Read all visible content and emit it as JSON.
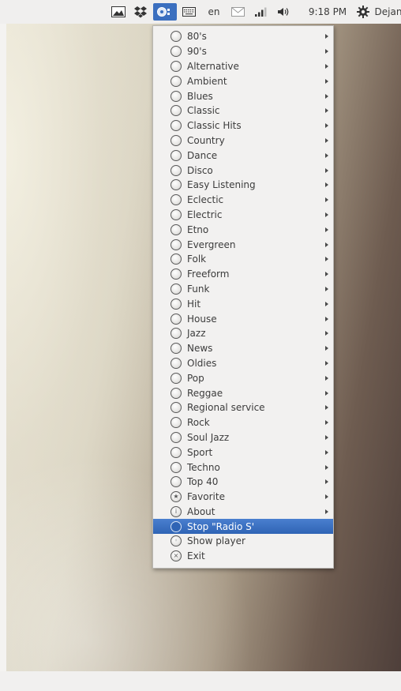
{
  "panel": {
    "language": "en",
    "clock": "9:18 PM",
    "user": "Dejan",
    "indicators": [
      {
        "name": "screenshot-icon"
      },
      {
        "name": "dropbox-icon"
      },
      {
        "name": "radio-tray-icon"
      },
      {
        "name": "keyboard-icon"
      },
      {
        "name": "mail-icon"
      },
      {
        "name": "network-signal-icon"
      },
      {
        "name": "volume-icon"
      },
      {
        "name": "gear-icon"
      }
    ]
  },
  "menu": {
    "items": [
      {
        "label": "80's",
        "submenu": true
      },
      {
        "label": "90's",
        "submenu": true
      },
      {
        "label": "Alternative",
        "submenu": true
      },
      {
        "label": "Ambient",
        "submenu": true
      },
      {
        "label": "Blues",
        "submenu": true
      },
      {
        "label": "Classic",
        "submenu": true
      },
      {
        "label": "Classic Hits",
        "submenu": true
      },
      {
        "label": "Country",
        "submenu": true
      },
      {
        "label": "Dance",
        "submenu": true
      },
      {
        "label": "Disco",
        "submenu": true
      },
      {
        "label": "Easy Listening",
        "submenu": true
      },
      {
        "label": "Eclectic",
        "submenu": true
      },
      {
        "label": "Electric",
        "submenu": true
      },
      {
        "label": "Etno",
        "submenu": true
      },
      {
        "label": "Evergreen",
        "submenu": true
      },
      {
        "label": "Folk",
        "submenu": true
      },
      {
        "label": "Freeform",
        "submenu": true
      },
      {
        "label": "Funk",
        "submenu": true
      },
      {
        "label": "Hit",
        "submenu": true
      },
      {
        "label": "House",
        "submenu": true
      },
      {
        "label": "Jazz",
        "submenu": true
      },
      {
        "label": "News",
        "submenu": true
      },
      {
        "label": "Oldies",
        "submenu": true
      },
      {
        "label": "Pop",
        "submenu": true
      },
      {
        "label": "Reggae",
        "submenu": true
      },
      {
        "label": "Regional service",
        "submenu": true
      },
      {
        "label": "Rock",
        "submenu": true
      },
      {
        "label": "Soul Jazz",
        "submenu": true
      },
      {
        "label": "Sport",
        "submenu": true
      },
      {
        "label": "Techno",
        "submenu": true
      },
      {
        "label": "Top 40",
        "submenu": true
      },
      {
        "label": "Favorite",
        "submenu": true,
        "icon": "star"
      },
      {
        "label": "About",
        "submenu": true,
        "icon": "info"
      },
      {
        "label": "Stop \"Radio S'",
        "submenu": false,
        "active": true,
        "icon": "stop"
      },
      {
        "label": "Show player",
        "submenu": false,
        "icon": "player"
      },
      {
        "label": "Exit",
        "submenu": false,
        "icon": "exit"
      }
    ]
  }
}
